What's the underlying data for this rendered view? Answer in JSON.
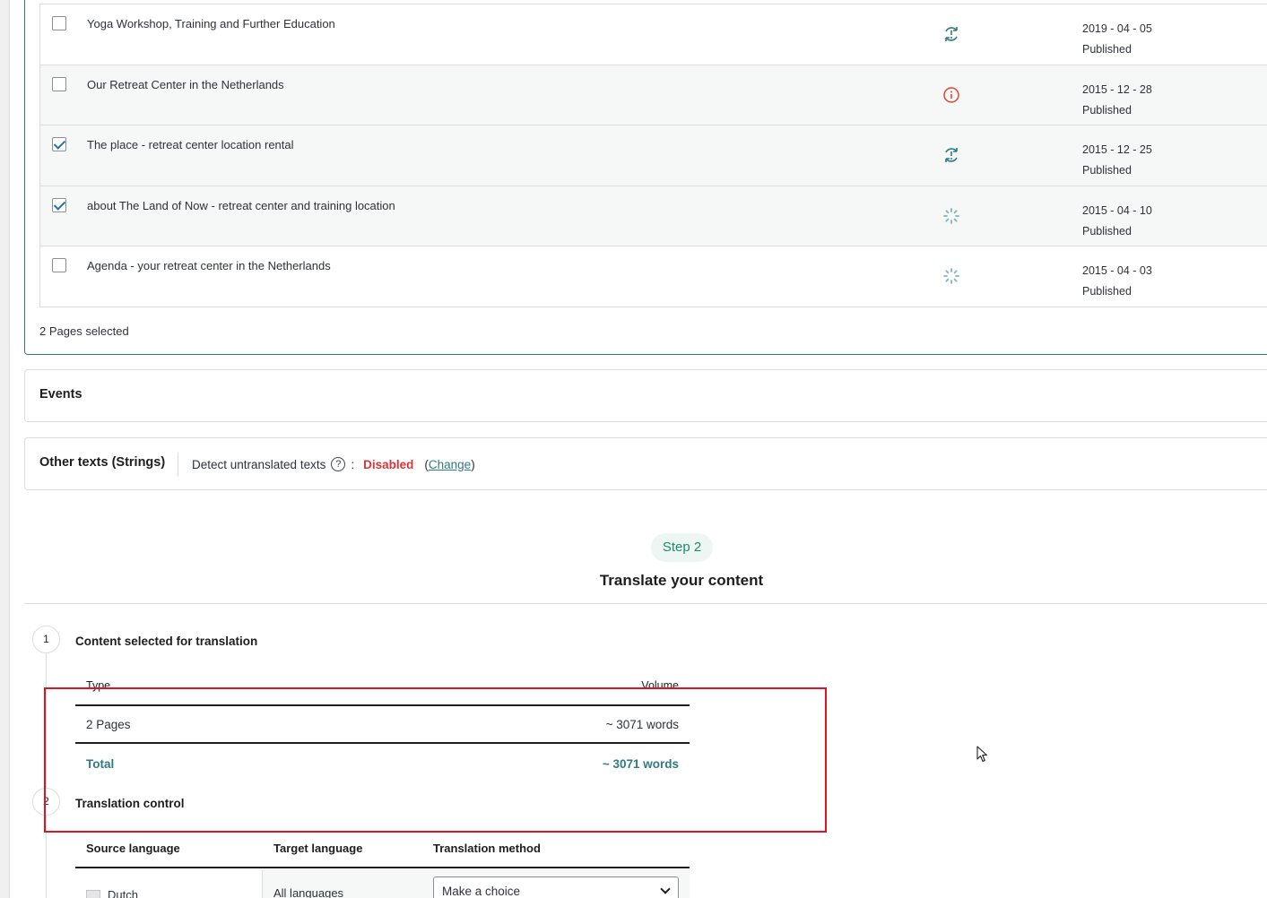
{
  "pages": {
    "rows": [
      {
        "title": "Yoga Workshop, Training and Further Education",
        "checked": false,
        "status_icon": "needs-update-icon",
        "date": "2019 - 04 - 05",
        "state": "Published"
      },
      {
        "title": "Our Retreat Center in the Netherlands",
        "checked": false,
        "status_icon": "warning-info-icon",
        "date": "2015 - 12 - 28",
        "state": "Published"
      },
      {
        "title": "The place - retreat center location rental",
        "checked": true,
        "status_icon": "needs-update-icon",
        "date": "2015 - 12 - 25",
        "state": "Published"
      },
      {
        "title": "about The Land of Now - retreat center and training location",
        "checked": true,
        "status_icon": "in-progress-icon",
        "date": "2015 - 04 - 10",
        "state": "Published"
      },
      {
        "title": "Agenda - your retreat center in the Netherlands",
        "checked": false,
        "status_icon": "in-progress-icon",
        "date": "2015 - 04 - 03",
        "state": "Published"
      }
    ],
    "selected_count": "2 Pages selected"
  },
  "events": {
    "heading": "Events"
  },
  "strings": {
    "heading": "Other texts (Strings)",
    "detect_label": "Detect untranslated texts",
    "colon": ":",
    "status": "Disabled",
    "paren_open": "(",
    "change_link": "Change",
    "paren_close": ")"
  },
  "step": {
    "pill": "Step 2",
    "title": "Translate your content"
  },
  "content_selected": {
    "number": "1",
    "title": "Content selected for translation",
    "col_type": "Type",
    "col_volume": "Volume",
    "row_type": "2 Pages",
    "row_volume": "~ 3071 words",
    "total_label": "Total",
    "total_volume": "~ 3071 words"
  },
  "translation_control": {
    "number": "2",
    "title": "Translation control",
    "col_source": "Source language",
    "col_target": "Target language",
    "col_method": "Translation method",
    "source": "Dutch",
    "target": "All languages",
    "method_value": "Make a choice"
  },
  "colors": {
    "accent": "#2f7a85",
    "error": "#d63638",
    "highlight_box": "#e0141e",
    "step_green": "#1b8a6b"
  }
}
